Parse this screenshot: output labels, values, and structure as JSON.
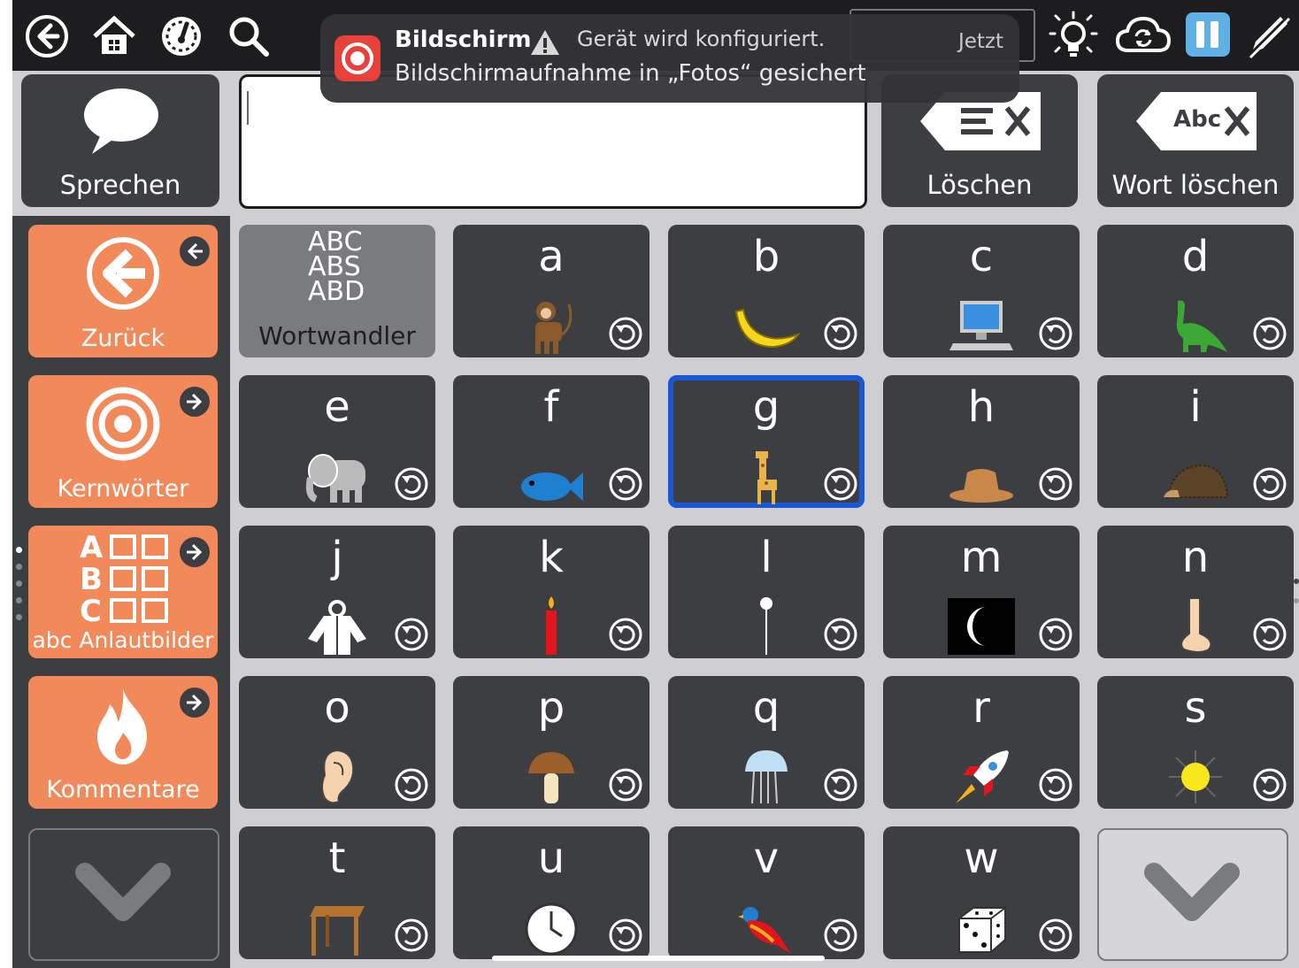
{
  "notification": {
    "title": "Bildschirm",
    "warning": "Gerät wird konfiguriert.",
    "body": "Bildschirmaufnahme in „Fotos“ gesichert",
    "time": "Jetzt"
  },
  "topbar": {
    "icons": [
      "back-icon",
      "home-icon",
      "speedometer-icon",
      "search-icon",
      "lightbulb-icon",
      "cloud-sync-icon",
      "pause-icon",
      "edit-pencil-icon"
    ]
  },
  "speak": {
    "label": "Sprechen"
  },
  "message": {
    "value": ""
  },
  "clear": {
    "label": "Löschen"
  },
  "delete_word": {
    "label": "Wort löschen",
    "icon_text": "Abc"
  },
  "left_nav": [
    {
      "label": "Zurück",
      "icon": "back-arrow-icon"
    },
    {
      "label": "Kernwörter",
      "icon": "target-icon"
    },
    {
      "label": "abc Anlautbilder",
      "icon": "abc-grid-icon"
    },
    {
      "label": "Kommentare",
      "icon": "flame-icon"
    }
  ],
  "wortwandler": {
    "label": "Wortwandler",
    "lines": [
      "ABC",
      "ABS",
      "ABD"
    ]
  },
  "tiles": [
    {
      "letter": "a",
      "picture": "monkey"
    },
    {
      "letter": "b",
      "picture": "banana"
    },
    {
      "letter": "c",
      "picture": "computer"
    },
    {
      "letter": "d",
      "picture": "dinosaur"
    },
    {
      "letter": "e",
      "picture": "elephant"
    },
    {
      "letter": "f",
      "picture": "fish"
    },
    {
      "letter": "g",
      "picture": "giraffe",
      "selected": true
    },
    {
      "letter": "h",
      "picture": "hat"
    },
    {
      "letter": "i",
      "picture": "hedgehog"
    },
    {
      "letter": "j",
      "picture": "jacket"
    },
    {
      "letter": "k",
      "picture": "candle"
    },
    {
      "letter": "l",
      "picture": "lollipop"
    },
    {
      "letter": "m",
      "picture": "moon"
    },
    {
      "letter": "n",
      "picture": "nose"
    },
    {
      "letter": "o",
      "picture": "ear"
    },
    {
      "letter": "p",
      "picture": "mushroom"
    },
    {
      "letter": "q",
      "picture": "jellyfish"
    },
    {
      "letter": "r",
      "picture": "rocket"
    },
    {
      "letter": "s",
      "picture": "sun"
    },
    {
      "letter": "t",
      "picture": "table"
    },
    {
      "letter": "u",
      "picture": "clock"
    },
    {
      "letter": "v",
      "picture": "bird"
    },
    {
      "letter": "w",
      "picture": "dice"
    }
  ],
  "colors": {
    "tile": "#3d3e41",
    "accent": "#f2895a",
    "selected": "#1a57d6",
    "background": "#cfcfd3"
  }
}
